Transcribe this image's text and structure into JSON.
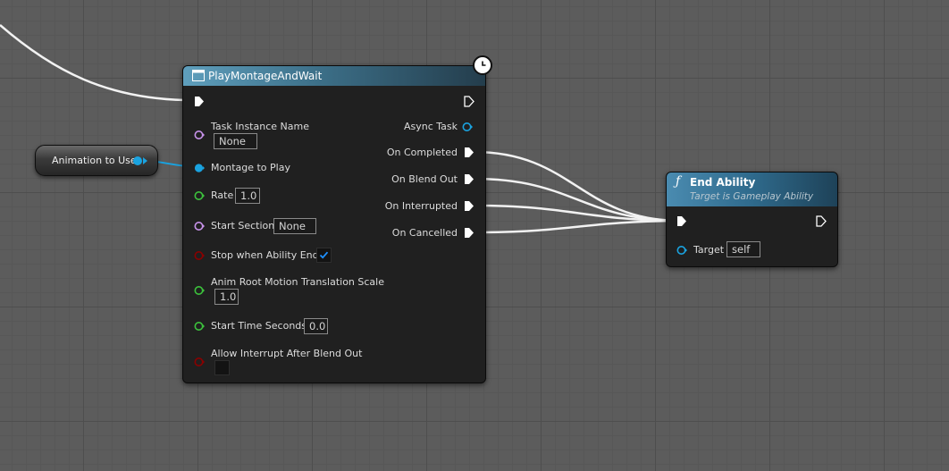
{
  "graph": {
    "variable_node": {
      "label": "Animation to Use",
      "pin_color": "#1aa3e0"
    },
    "play_montage_node": {
      "title": "PlayMontageAndWait",
      "latent_icon": "clock-icon",
      "header_color": "#4f8aa8",
      "inputs": {
        "task_instance_name": {
          "label": "Task Instance Name",
          "value": "None"
        },
        "montage_to_play": {
          "label": "Montage to Play"
        },
        "rate": {
          "label": "Rate",
          "value": "1.0"
        },
        "start_section": {
          "label": "Start Section",
          "value": "None"
        },
        "stop_when_ability_ends": {
          "label": "Stop when Ability Ends",
          "checked": true
        },
        "anim_root_motion_translation_scale": {
          "label": "Anim Root Motion Translation Scale",
          "value": "1.0"
        },
        "start_time_seconds": {
          "label": "Start Time Seconds",
          "value": "0.0"
        },
        "allow_interrupt_after_blend_out": {
          "label": "Allow Interrupt After Blend Out",
          "checked": false
        }
      },
      "outputs": {
        "async_task": "Async Task",
        "on_completed": "On Completed",
        "on_blend_out": "On Blend Out",
        "on_interrupted": "On Interrupted",
        "on_cancelled": "On Cancelled"
      }
    },
    "end_ability_node": {
      "icon": "function-icon",
      "title": "End Ability",
      "subtitle": "Target is Gameplay Ability",
      "target_label": "Target",
      "target_value": "self"
    },
    "pin_colors": {
      "exec": "#ffffff",
      "name": "#c792ea",
      "object": "#1aa3e0",
      "float": "#3cc23c",
      "bool": "#8a0000"
    }
  }
}
